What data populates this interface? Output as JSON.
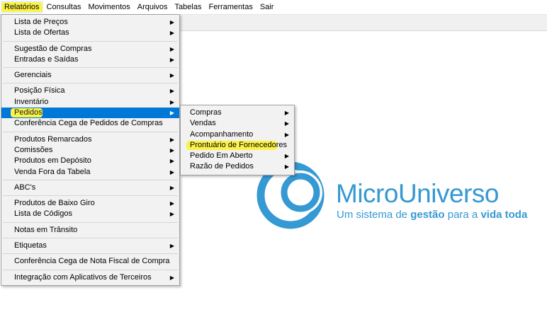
{
  "menubar": {
    "items": [
      "Relatórios",
      "Consultas",
      "Movimentos",
      "Arquivos",
      "Tabelas",
      "Ferramentas",
      "Sair"
    ]
  },
  "relatorios_menu": {
    "items": [
      {
        "label": "Lista de Preços",
        "submenu": true
      },
      {
        "label": "Lista de Ofertas",
        "submenu": true
      },
      {
        "label": "Sugestão de Compras",
        "submenu": true
      },
      {
        "label": "Entradas e Saídas",
        "submenu": true
      },
      {
        "label": "Gerenciais",
        "submenu": true
      },
      {
        "label": "Posição Física",
        "submenu": true
      },
      {
        "label": "Inventário",
        "submenu": true
      },
      {
        "label": "Pedidos",
        "submenu": true
      },
      {
        "label": "Conferência Cega de Pedidos de Compras",
        "submenu": false
      },
      {
        "label": "Produtos Remarcados",
        "submenu": true
      },
      {
        "label": "Comissões",
        "submenu": true
      },
      {
        "label": "Produtos em Depósito",
        "submenu": true
      },
      {
        "label": "Venda Fora da Tabela",
        "submenu": true
      },
      {
        "label": "ABC's",
        "submenu": true
      },
      {
        "label": "Produtos de Baixo Giro",
        "submenu": true
      },
      {
        "label": "Lista de Códigos",
        "submenu": true
      },
      {
        "label": "Notas em Trânsito",
        "submenu": false
      },
      {
        "label": "Etiquetas",
        "submenu": true
      },
      {
        "label": "Conferência Cega de Nota Fiscal de Compra",
        "submenu": false
      },
      {
        "label": "Integração com Aplicativos de Terceiros",
        "submenu": true
      }
    ]
  },
  "pedidos_menu": {
    "items": [
      {
        "label": "Compras",
        "submenu": true
      },
      {
        "label": "Vendas",
        "submenu": true
      },
      {
        "label": "Acompanhamento",
        "submenu": true
      },
      {
        "label": "Prontuário de Fornecedores",
        "submenu": false
      },
      {
        "label": "Pedido Em Aberto",
        "submenu": true
      },
      {
        "label": "Razão de Pedidos",
        "submenu": true
      }
    ]
  },
  "submenu_arrow": "▶",
  "logo": {
    "name": "MicroUniverso",
    "tagline_parts": [
      "Um sistema de ",
      "gestão",
      " para a ",
      "vida toda"
    ],
    "color": "#3599d3"
  },
  "colors": {
    "selection": "#0078d7",
    "highlight": "#fcf34a"
  }
}
